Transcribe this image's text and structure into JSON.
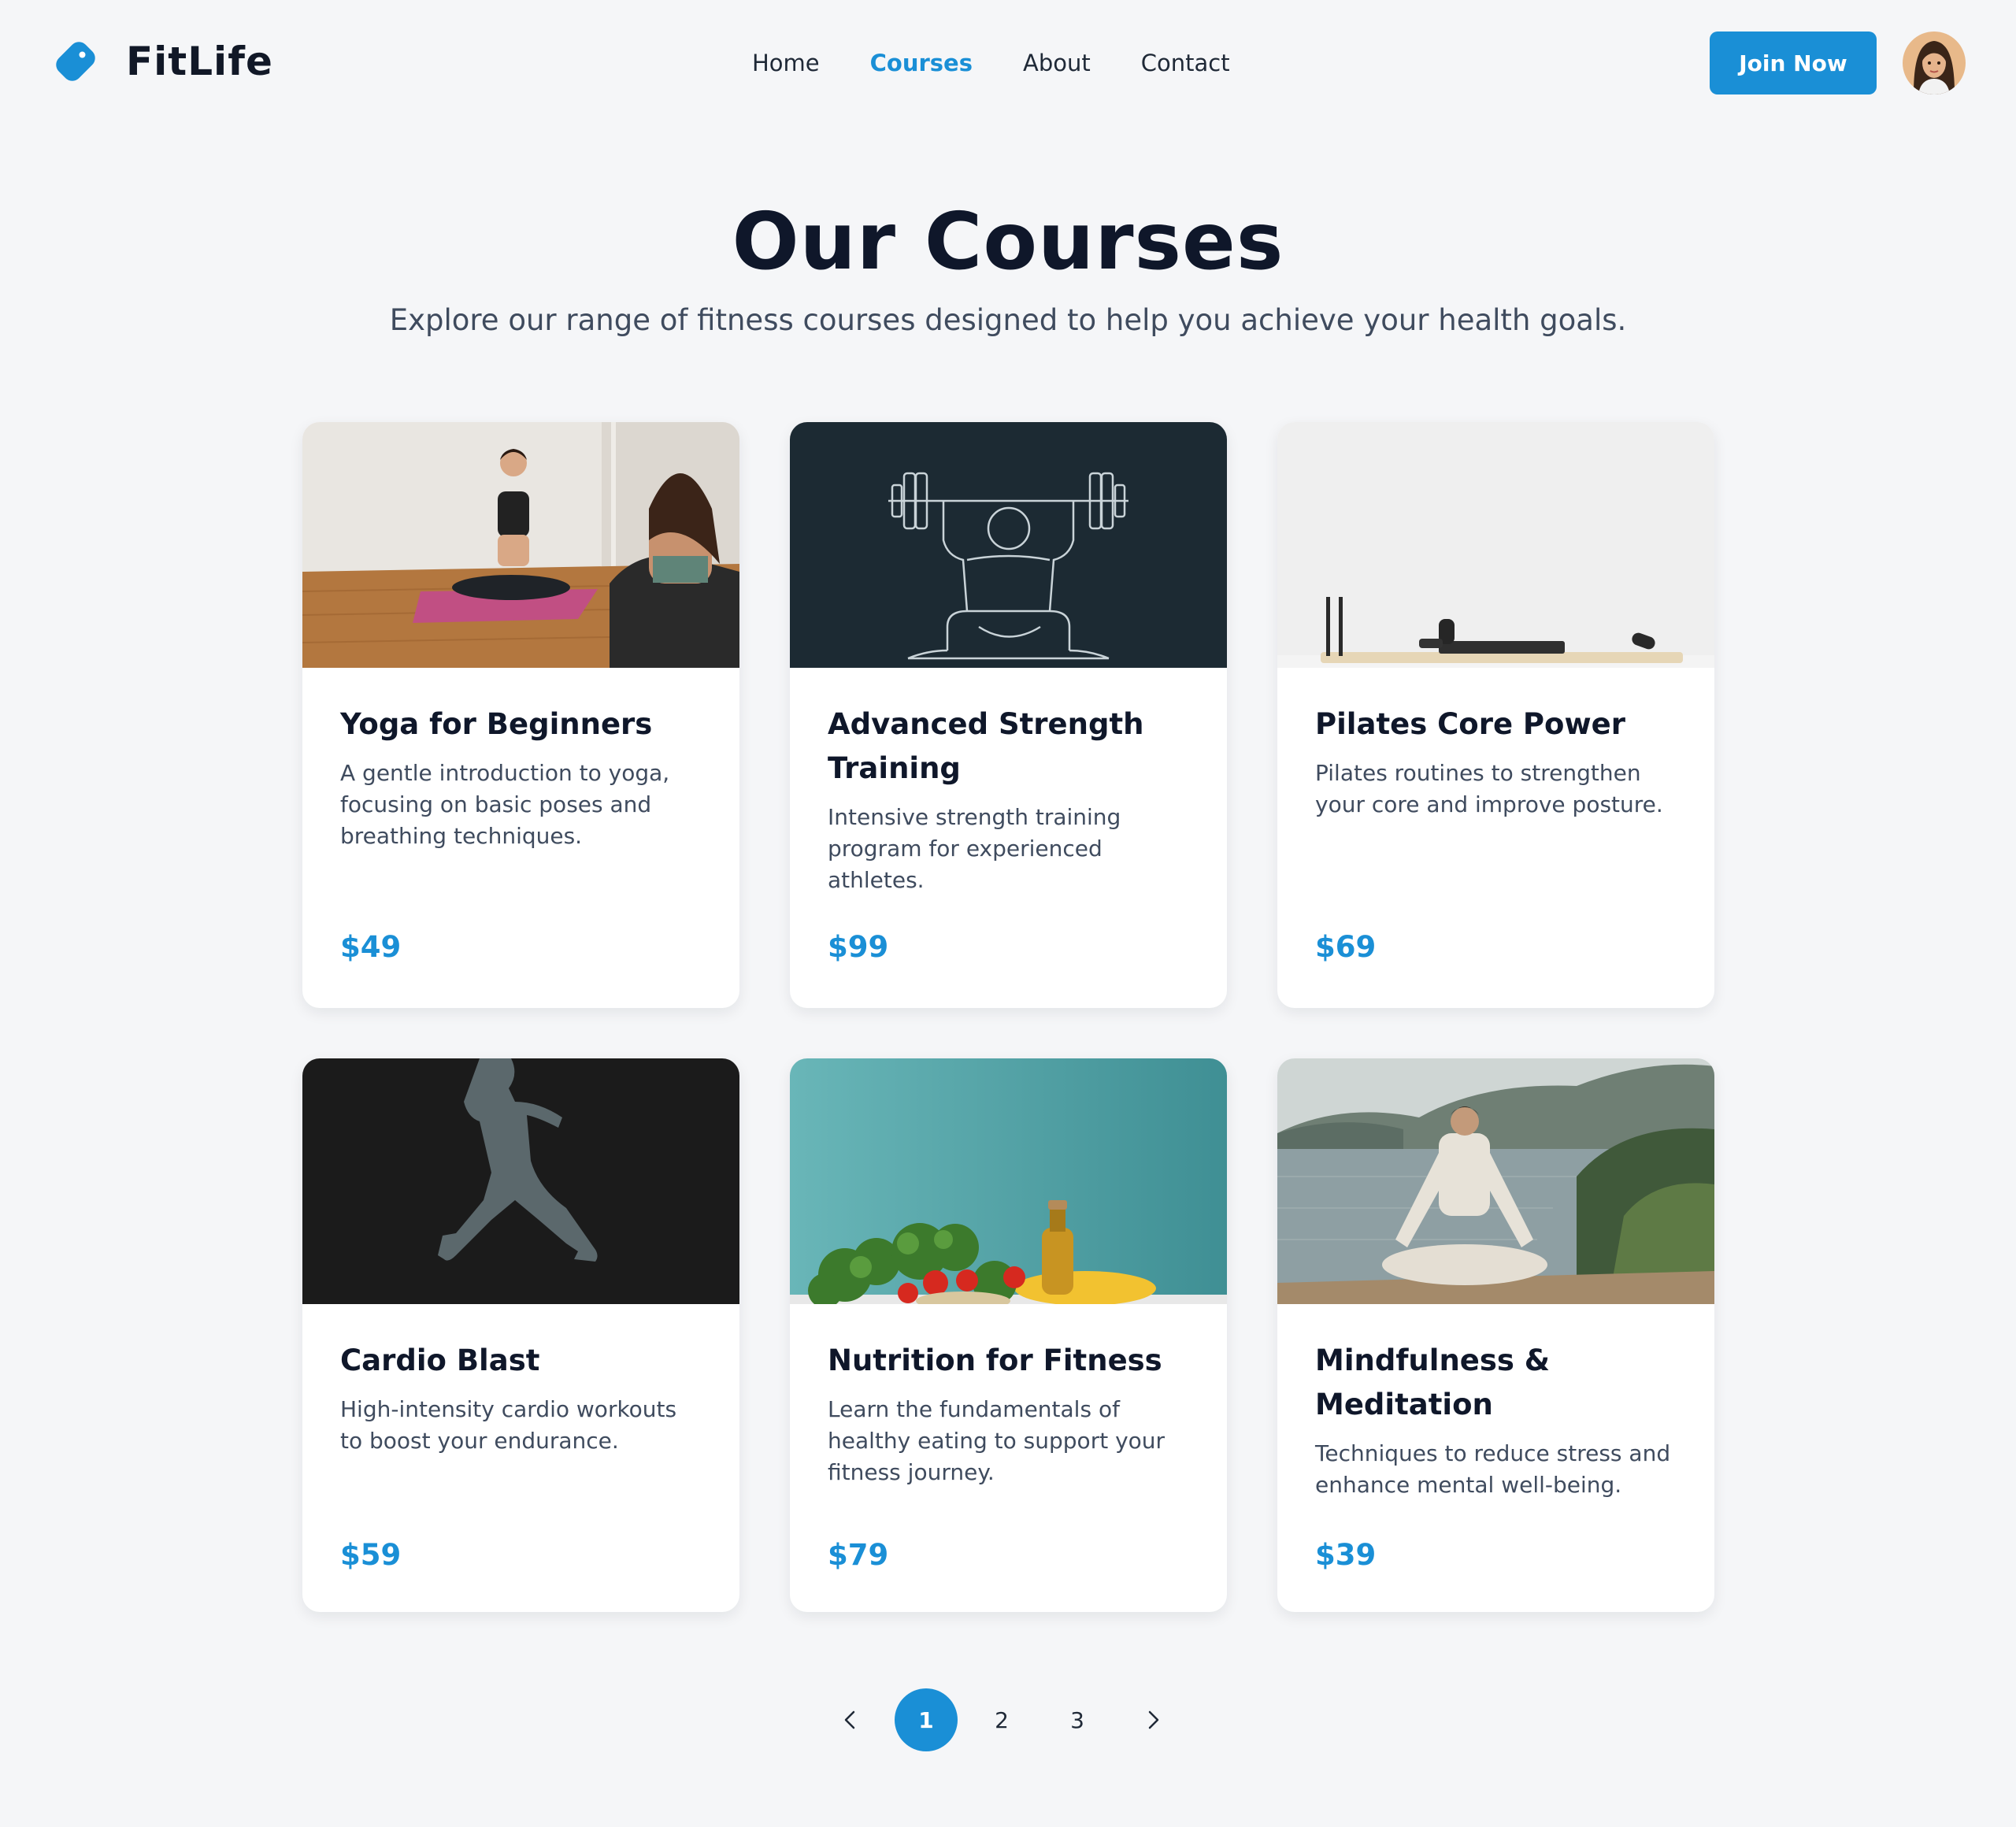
{
  "brand": {
    "name": "FitLife",
    "accent": "#1a8fd6",
    "logo_icon": "tag-icon"
  },
  "nav": {
    "items": [
      {
        "label": "Home",
        "active": false
      },
      {
        "label": "Courses",
        "active": true
      },
      {
        "label": "About",
        "active": false
      },
      {
        "label": "Contact",
        "active": false
      }
    ]
  },
  "header": {
    "join_label": "Join Now",
    "avatar_icon": "user-avatar"
  },
  "hero": {
    "title": "Our Courses",
    "subtitle": "Explore our range of fitness courses designed to help you achieve your health goals."
  },
  "courses": [
    {
      "title": "Yoga for Beginners",
      "description": "A gentle introduction to yoga, focusing on basic poses and breathing techniques.",
      "price": "$49",
      "image_icon": "yoga-class-photo"
    },
    {
      "title": "Advanced Strength Training",
      "description": "Intensive strength training program for experienced athletes.",
      "price": "$99",
      "image_icon": "barbell-lifter-illustration"
    },
    {
      "title": "Pilates Core Power",
      "description": "Pilates routines to strengthen your core and improve posture.",
      "price": "$69",
      "image_icon": "pilates-reformer-photo"
    },
    {
      "title": "Cardio Blast",
      "description": "High-intensity cardio workouts to boost your endurance.",
      "price": "$59",
      "image_icon": "runner-silhouette"
    },
    {
      "title": "Nutrition for Fitness",
      "description": "Learn the fundamentals of healthy eating to support your fitness journey.",
      "price": "$79",
      "image_icon": "healthy-food-photo"
    },
    {
      "title": "Mindfulness & Meditation",
      "description": "Techniques to reduce stress and enhance mental well-being.",
      "price": "$39",
      "image_icon": "meditation-lake-photo"
    }
  ],
  "pagination": {
    "pages": [
      "1",
      "2",
      "3"
    ],
    "current": "1",
    "prev_icon": "chevron-left-icon",
    "next_icon": "chevron-right-icon"
  }
}
